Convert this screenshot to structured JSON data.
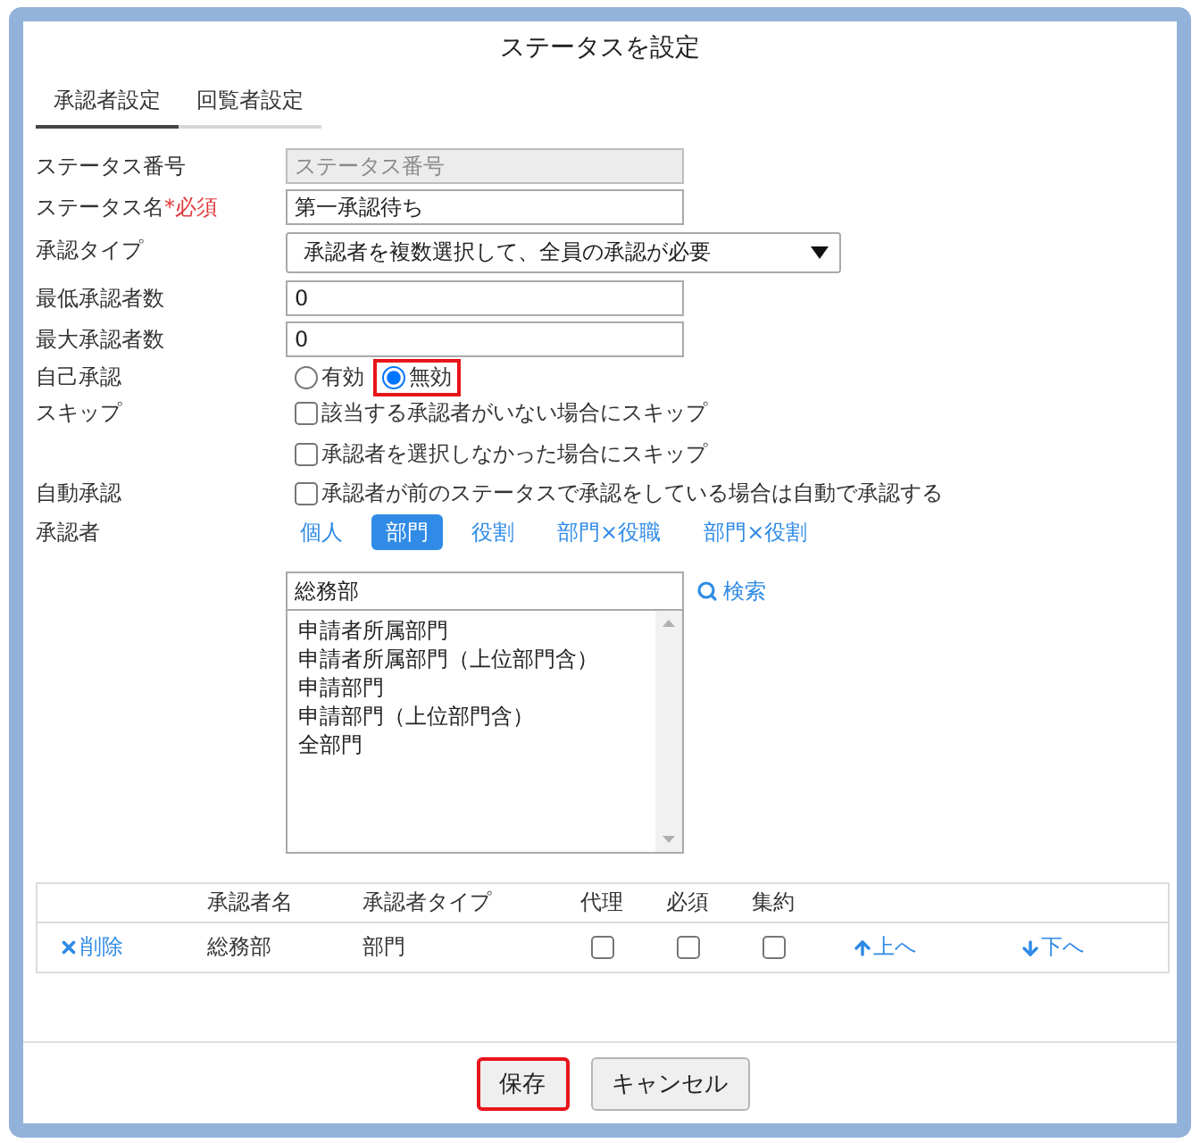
{
  "dialog": {
    "title": "ステータスを設定"
  },
  "tabs": [
    {
      "label": "承認者設定",
      "selected": true
    },
    {
      "label": "回覧者設定",
      "selected": false
    }
  ],
  "fields": [
    {
      "kind": "text",
      "label": "ステータス番号",
      "placeholder": "ステータス番号",
      "disabled": true
    },
    {
      "kind": "text",
      "label": "ステータス名",
      "required_mark": "*必須",
      "value": "第一承認待ち",
      "disabled": false
    },
    {
      "kind": "select",
      "label": "承認タイプ",
      "value": "承認者を複数選択して、全員の承認が必要"
    },
    {
      "kind": "text",
      "label": "最低承認者数",
      "value": "0",
      "disabled": false
    },
    {
      "kind": "text",
      "label": "最大承認者数",
      "value": "0",
      "disabled": false
    },
    {
      "kind": "radio",
      "label": "自己承認",
      "options": [
        {
          "label": "有効",
          "selected": false,
          "highlighted": false
        },
        {
          "label": "無効",
          "selected": true,
          "highlighted": true
        }
      ]
    },
    {
      "kind": "checkbox",
      "label": "スキップ",
      "options": [
        {
          "label": "該当する承認者がいない場合にスキップ",
          "checked": false
        },
        {
          "label": "承認者を選択しなかった場合にスキップ",
          "checked": false
        }
      ]
    },
    {
      "kind": "checkbox",
      "label": "自動承認",
      "options": [
        {
          "label": "承認者が前のステータスで承認をしている場合は自動で承認する",
          "checked": false
        }
      ]
    },
    {
      "kind": "approver",
      "label": "承認者",
      "types": [
        {
          "label": "個人",
          "selected": false
        },
        {
          "label": "部門",
          "selected": true
        },
        {
          "label": "役割",
          "selected": false
        },
        {
          "label": "部門×役職",
          "selected": false
        },
        {
          "label": "部門×役割",
          "selected": false
        }
      ],
      "search": {
        "value": "総務部",
        "button": "検索"
      },
      "list": [
        "申請者所属部門",
        "申請者所属部門（上位部門含）",
        "申請部門",
        "申請部門（上位部門含）",
        "全部門"
      ]
    }
  ],
  "table": {
    "columns": [
      "承認者名",
      "承認者タイプ",
      "代理",
      "必須",
      "集約"
    ],
    "rows": [
      {
        "delete": "削除",
        "name": "総務部",
        "type": "部門",
        "proxy": false,
        "required": false,
        "aggregate": false,
        "move_up": "上へ",
        "move_down": "下へ"
      }
    ]
  },
  "buttons": [
    {
      "label": "保存",
      "highlighted": true
    },
    {
      "label": "キャンセル",
      "highlighted": false
    }
  ]
}
